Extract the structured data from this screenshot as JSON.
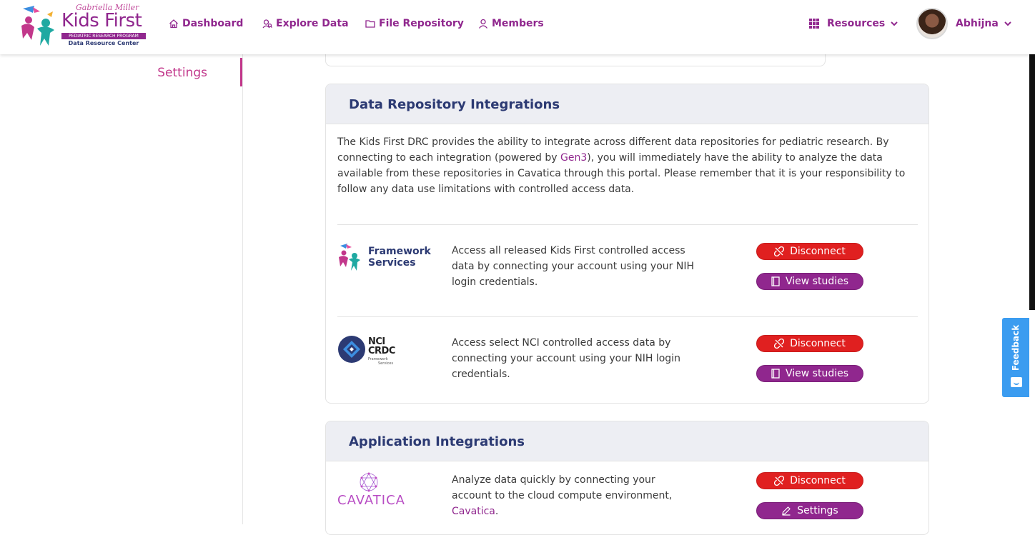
{
  "header": {
    "logo": {
      "script": "Gabriella Miller",
      "brand": "Kids First",
      "program": "PEDIATRIC RESEARCH PROGRAM",
      "center": "Data Resource Center"
    },
    "nav": [
      {
        "label": "Dashboard",
        "icon": "home-icon"
      },
      {
        "label": "Explore Data",
        "icon": "explore-icon"
      },
      {
        "label": "File Repository",
        "icon": "folder-icon"
      },
      {
        "label": "Members",
        "icon": "user-icon"
      }
    ],
    "resources_label": "Resources",
    "user_name": "Abhijna"
  },
  "sidebar": {
    "items": [
      {
        "label": "Settings",
        "active": true
      }
    ]
  },
  "data_repo": {
    "title": "Data Repository Integrations",
    "intro_before": "The Kids First DRC provides the ability to integrate across different data repositories for pediatric research. By connecting to each integration (powered by ",
    "intro_link": "Gen3",
    "intro_after": "), you will immediately have the ability to analyze the data available from these repositories in Cavatica through this portal. Please remember that it is your responsibility to follow any data use limitations with controlled access data.",
    "integrations": [
      {
        "logo_line1": "Framework",
        "logo_line2": "Services",
        "description": "Access all released Kids First controlled access data by connecting your account using your NIH login credentials.",
        "disconnect_label": "Disconnect",
        "studies_label": "View studies"
      },
      {
        "logo_line1": "NCI",
        "logo_line2": "CRDC",
        "logo_line3": "Framework",
        "logo_line4": "Services",
        "description": "Access select NCI controlled access data by connecting your account using your NIH login credentials.",
        "disconnect_label": "Disconnect",
        "studies_label": "View studies"
      }
    ]
  },
  "app_integrations": {
    "title": "Application Integrations",
    "items": [
      {
        "logo_text": "CAVATICA",
        "description_before": "Analyze data quickly by connecting your account to the cloud compute environment, ",
        "description_link": "Cavatica",
        "description_after": ".",
        "disconnect_label": "Disconnect",
        "settings_label": "Settings"
      }
    ]
  },
  "feedback_label": "Feedback",
  "colors": {
    "brand_purple": "#90278e",
    "accent_pink": "#c2378b",
    "navy": "#2c3a73",
    "danger_red": "#e02020",
    "feedback_blue": "#3b9cf0"
  }
}
